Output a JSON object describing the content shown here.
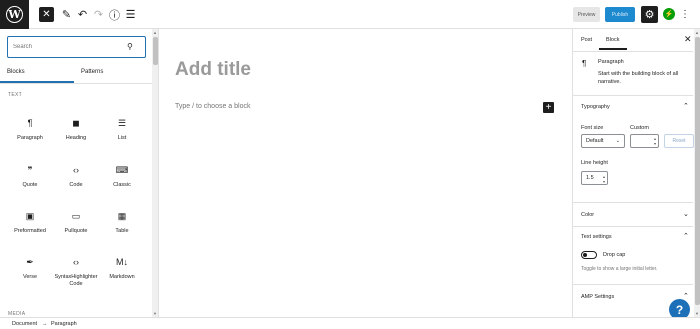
{
  "toolbar": {
    "preview_label": "Preview",
    "publish_label": "Publish",
    "colors": {
      "publish_bg": "#1d8ad0",
      "jetpack": "#069e08",
      "accent": "#2271b1"
    }
  },
  "inserter": {
    "search": {
      "placeholder": "Search",
      "value": ""
    },
    "tabs": [
      {
        "label": "Blocks",
        "active": true
      },
      {
        "label": "Patterns",
        "active": false
      }
    ],
    "section_text": "TEXT",
    "section_media": "MEDIA",
    "blocks": [
      {
        "label": "Paragraph",
        "icon": "paragraph-icon",
        "glyph": "¶"
      },
      {
        "label": "Heading",
        "icon": "heading-icon",
        "glyph": "🔖"
      },
      {
        "label": "List",
        "icon": "list-icon",
        "glyph": "☰"
      },
      {
        "label": "Quote",
        "icon": "quote-icon",
        "glyph": "❞"
      },
      {
        "label": "Code",
        "icon": "code-icon",
        "glyph": "‹›"
      },
      {
        "label": "Classic",
        "icon": "classic-icon",
        "glyph": "⌨"
      },
      {
        "label": "Preformatted",
        "icon": "preformatted-icon",
        "glyph": "▣"
      },
      {
        "label": "Pullquote",
        "icon": "pullquote-icon",
        "glyph": "▭"
      },
      {
        "label": "Table",
        "icon": "table-icon",
        "glyph": "▦"
      },
      {
        "label": "Verse",
        "icon": "verse-icon",
        "glyph": "✒"
      },
      {
        "label": "SyntaxHighlighter Code",
        "icon": "syntax-code-icon",
        "glyph": "‹›"
      },
      {
        "label": "Markdown",
        "icon": "markdown-icon",
        "glyph": "M↓"
      }
    ]
  },
  "canvas": {
    "title_placeholder": "Add title",
    "block_placeholder": "Type / to choose a block"
  },
  "sidebar": {
    "tabs": [
      {
        "label": "Post",
        "active": false
      },
      {
        "label": "Block",
        "active": true
      }
    ],
    "block_card": {
      "name": "Paragraph",
      "description": "Start with the building block of all narrative."
    },
    "typography": {
      "title": "Typography",
      "font_size_label": "Font size",
      "custom_label": "Custom",
      "font_size_value": "Default",
      "custom_value": "",
      "reset_label": "Reset",
      "line_height_label": "Line height",
      "line_height_value": "1.5"
    },
    "color_title": "Color",
    "text_settings": {
      "title": "Text settings",
      "drop_cap_label": "Drop cap",
      "drop_cap_on": false,
      "help": "Toggle to show a large initial letter."
    },
    "amp_title": "AMP Settings"
  },
  "footer": {
    "breadcrumb": [
      "Document",
      "Paragraph"
    ],
    "separator": "→"
  },
  "help_glyph": "?"
}
